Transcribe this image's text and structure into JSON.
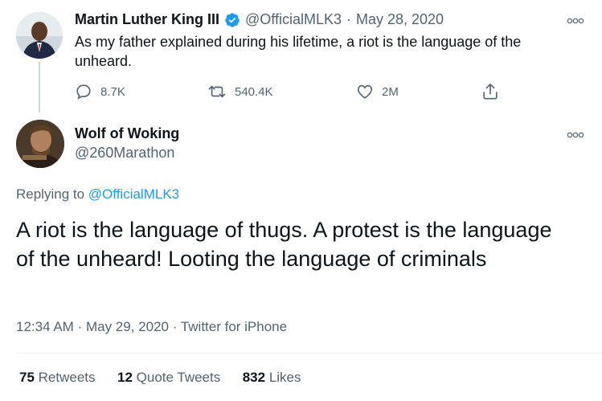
{
  "tweet1": {
    "name": "Martin Luther King III",
    "handle": "@OfficialMLK3",
    "separator": "·",
    "date": "May 28, 2020",
    "text": "As my father explained during his lifetime, a riot is the language of the unheard.",
    "actions": {
      "reply_count": "8.7K",
      "retweet_count": "540.4K",
      "like_count": "2M"
    }
  },
  "tweet2": {
    "name": "Wolf of Woking",
    "handle": "@260Marathon",
    "replying_prefix": "Replying to",
    "replying_to": "@OfficialMLK3",
    "text": "A riot is the language of thugs. A protest is the language of the unheard! Looting the language of criminals",
    "time": "12:34 AM",
    "separator": "·",
    "date": "May 29, 2020",
    "separator2": "·",
    "source": "Twitter for iPhone",
    "stats": {
      "retweets_count": "75",
      "retweets_label": "Retweets",
      "quotes_count": "12",
      "quotes_label": "Quote Tweets",
      "likes_count": "832",
      "likes_label": "Likes"
    }
  },
  "colors": {
    "accent": "#1d9bf0",
    "secondary_text": "#536471",
    "verified": "#1d9bf0"
  },
  "icons": [
    "more-icon",
    "verified-icon",
    "reply-icon",
    "retweet-icon",
    "like-icon",
    "share-icon"
  ]
}
